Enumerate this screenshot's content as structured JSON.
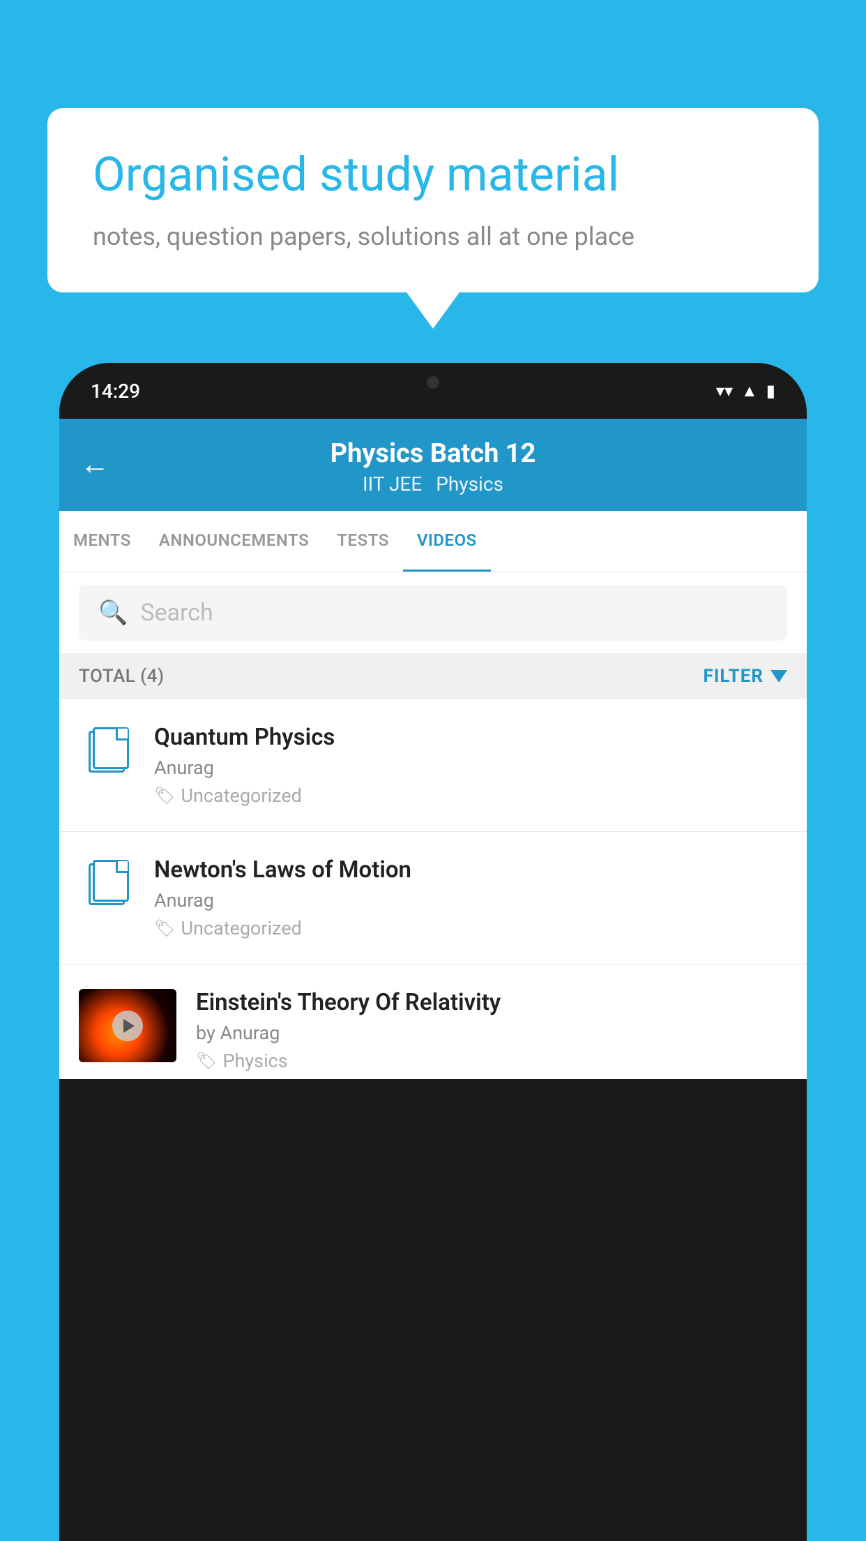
{
  "background_color": "#29b6e8",
  "speech_bubble": {
    "heading": "Organised study material",
    "subtext": "notes, question papers, solutions all at one place"
  },
  "phone": {
    "status_bar": {
      "time": "14:29",
      "icons": [
        "wifi",
        "signal",
        "battery"
      ]
    },
    "header": {
      "back_label": "←",
      "title": "Physics Batch 12",
      "subtitle1": "IIT JEE",
      "subtitle2": "Physics"
    },
    "tabs": [
      {
        "label": "MENTS",
        "active": false
      },
      {
        "label": "ANNOUNCEMENTS",
        "active": false
      },
      {
        "label": "TESTS",
        "active": false
      },
      {
        "label": "VIDEOS",
        "active": true
      }
    ],
    "search": {
      "placeholder": "Search"
    },
    "filter_bar": {
      "total_label": "TOTAL (4)",
      "filter_label": "FILTER"
    },
    "videos": [
      {
        "id": 1,
        "title": "Quantum Physics",
        "author": "Anurag",
        "tag": "Uncategorized",
        "has_thumb": false
      },
      {
        "id": 2,
        "title": "Newton's Laws of Motion",
        "author": "Anurag",
        "tag": "Uncategorized",
        "has_thumb": false
      },
      {
        "id": 3,
        "title": "Einstein's Theory Of Relativity",
        "author": "by Anurag",
        "tag": "Physics",
        "has_thumb": true
      }
    ]
  }
}
